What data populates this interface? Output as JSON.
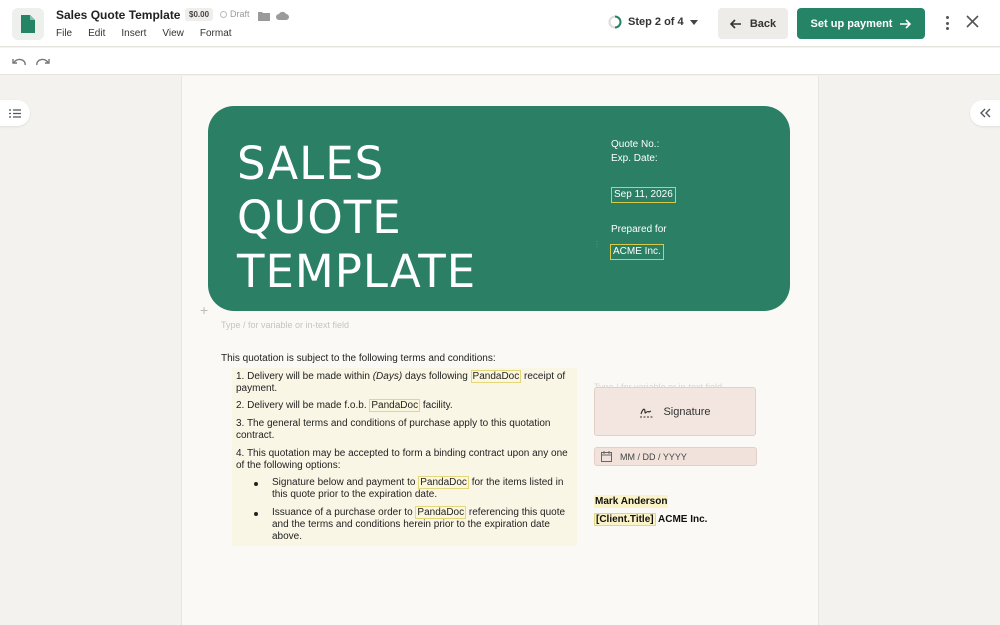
{
  "header": {
    "doc_title": "Sales Quote Template",
    "price": "$0.00",
    "status": "Draft",
    "menu": [
      "File",
      "Edit",
      "Insert",
      "View",
      "Format"
    ],
    "step": "Step 2 of 4",
    "back_label": "Back",
    "payment_label": "Set up payment"
  },
  "hero": {
    "title_line1": "SALES",
    "title_line2": "QUOTE",
    "title_line3": "TEMPLATE",
    "quote_no_label": "Quote No.:",
    "exp_date_label": "Exp. Date:",
    "exp_date_value": "Sep 11, 2026",
    "prepared_for_label": "Prepared for",
    "client_company": "ACME Inc."
  },
  "body": {
    "block_placeholder": "Type / for variable or in-text field",
    "terms_intro": "This quotation is subject to the following terms and conditions:",
    "term1_a": "1. Delivery will be made within ",
    "term1_days": "(Days)",
    "term1_b": " days following ",
    "term1_company": "PandaDoc",
    "term1_c": " receipt of payment.",
    "term2_a": "2. Delivery will be made f.o.b. ",
    "term2_company": "PandaDoc",
    "term2_b": " facility.",
    "term3": "3. The general terms and conditions of purchase apply to this quotation contract.",
    "term4": "4. This quotation may be accepted to form a binding contract upon any one of the following options:",
    "sub1_a": "Signature below and payment to ",
    "sub1_company": "PandaDoc",
    "sub1_b": " for the items listed in this quote prior to the expiration date.",
    "sub2_a": "Issuance of a purchase order to ",
    "sub2_company": "PandaDoc",
    "sub2_b": " referencing this quote and the terms and conditions herein prior to the expiration date above."
  },
  "signature": {
    "placeholder": "Type / for variable or in-text field",
    "signature_label": "Signature",
    "date_placeholder": "MM / DD / YYYY",
    "signer_name": "Mark Anderson",
    "client_title": "[Client.Title]",
    "client_company": "ACME Inc."
  },
  "colors": {
    "brand_green": "#268466",
    "hero_green": "#2a7f64",
    "signature_fill": "#f3e6e0",
    "variable_highlight": "#fbf3c8"
  },
  "icons": [
    "document-icon",
    "folder-icon",
    "cloud-icon",
    "step-progress-icon",
    "arrow-left-icon",
    "arrow-right-icon",
    "more-vertical-icon",
    "close-icon",
    "undo-icon",
    "redo-icon",
    "list-icon",
    "double-chevron-left-icon",
    "signature-icon",
    "calendar-icon",
    "plus-icon"
  ]
}
